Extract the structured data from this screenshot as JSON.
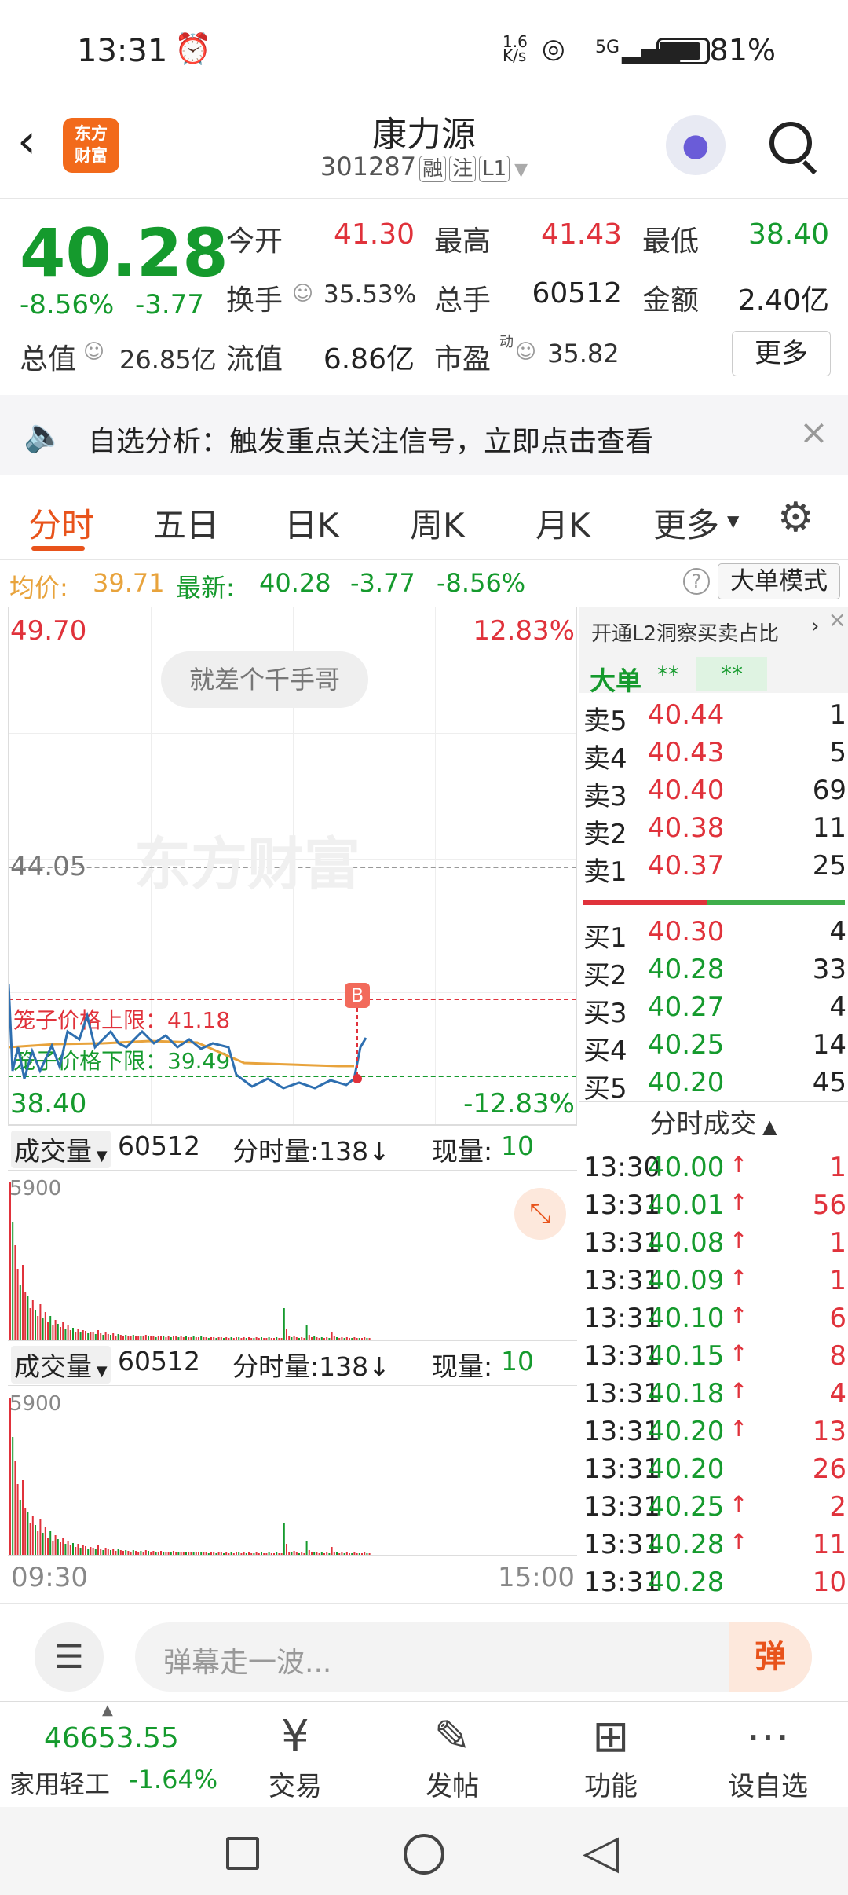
{
  "status": {
    "time": "13:31",
    "alarm_icon": "alarm-icon",
    "net_speed": "1.6 K/s",
    "signal": "5G",
    "battery": "81%"
  },
  "header": {
    "title": "康力源",
    "code": "301287",
    "tags": [
      "融",
      "注",
      "L1"
    ],
    "logo_line1": "东方",
    "logo_line2": "财富"
  },
  "quote": {
    "price": "40.28",
    "change_pct": "-8.56%",
    "change": "-3.77",
    "open_label": "今开",
    "open": "41.30",
    "high_label": "最高",
    "high": "41.43",
    "low_label": "最低",
    "low": "38.40",
    "turnover_label": "换手",
    "turnover": "35.53%",
    "volume_label": "总手",
    "volume": "60512",
    "amount_label": "金额",
    "amount": "2.40亿",
    "mcap_label": "总值",
    "mcap": "26.85亿",
    "float_label": "流值",
    "float": "6.86亿",
    "pe_label": "市盈",
    "pe_sup": "动",
    "pe": "35.82",
    "more_button": "更多"
  },
  "notice": {
    "text": "自选分析：触发重点关注信号，立即点击查看"
  },
  "tabs": [
    "分时",
    "五日",
    "日K",
    "周K",
    "月K",
    "更多"
  ],
  "infobar": {
    "avg_label": "均价:",
    "avg": "39.71",
    "latest_label": "最新:",
    "latest": "40.28",
    "chg": "-3.77",
    "pct": "-8.56%",
    "bigmode": "大单模式"
  },
  "chart": {
    "top_price": "49.70",
    "top_pct": "12.83%",
    "mid_price": "44.05",
    "bot_price": "38.40",
    "bot_pct": "-12.83%",
    "bubble": "就差个千手哥",
    "upper_limit": "笼子价格上限：41.18",
    "lower_limit": "笼子价格下限：39.49",
    "marker": "B",
    "watermark": "东方财富"
  },
  "volbar": {
    "label": "成交量",
    "total": "60512",
    "fs_label": "分时量:138↓",
    "now_label": "现量:",
    "now": "10",
    "max": "5900"
  },
  "axis": {
    "start": "09:30",
    "end": "15:00"
  },
  "book": {
    "promo": "开通L2洞察买卖占比",
    "bigorder": "大单",
    "stars": "**",
    "asks": [
      {
        "l": "卖5",
        "p": "40.44",
        "v": "1"
      },
      {
        "l": "卖4",
        "p": "40.43",
        "v": "5"
      },
      {
        "l": "卖3",
        "p": "40.40",
        "v": "69"
      },
      {
        "l": "卖2",
        "p": "40.38",
        "v": "11"
      },
      {
        "l": "卖1",
        "p": "40.37",
        "v": "25"
      }
    ],
    "bids": [
      {
        "l": "买1",
        "p": "40.30",
        "v": "4"
      },
      {
        "l": "买2",
        "p": "40.28",
        "v": "33"
      },
      {
        "l": "买3",
        "p": "40.27",
        "v": "4"
      },
      {
        "l": "买4",
        "p": "40.25",
        "v": "14"
      },
      {
        "l": "买5",
        "p": "40.20",
        "v": "45"
      }
    ],
    "ticks_title": "分时成交",
    "ticks": [
      {
        "t": "13:30",
        "p": "40.00",
        "v": "1",
        "up": true
      },
      {
        "t": "13:31",
        "p": "40.01",
        "v": "56",
        "up": true
      },
      {
        "t": "13:31",
        "p": "40.08",
        "v": "1",
        "up": true
      },
      {
        "t": "13:31",
        "p": "40.09",
        "v": "1",
        "up": true
      },
      {
        "t": "13:31",
        "p": "40.10",
        "v": "6",
        "up": true
      },
      {
        "t": "13:31",
        "p": "40.15",
        "v": "8",
        "up": true
      },
      {
        "t": "13:31",
        "p": "40.18",
        "v": "4",
        "up": true
      },
      {
        "t": "13:31",
        "p": "40.20",
        "v": "13",
        "up": true
      },
      {
        "t": "13:31",
        "p": "40.20",
        "v": "26",
        "up": false
      },
      {
        "t": "13:31",
        "p": "40.25",
        "v": "2",
        "up": true
      },
      {
        "t": "13:31",
        "p": "40.28",
        "v": "11",
        "up": true
      },
      {
        "t": "13:31",
        "p": "40.28",
        "v": "10",
        "up": false
      }
    ]
  },
  "danmu": {
    "placeholder": "弹幕走一波...",
    "send": "弹"
  },
  "toolbar": {
    "index_value": "46653.55",
    "index_name": "家用轻工",
    "index_pct": "-1.64%",
    "items": [
      "交易",
      "发帖",
      "功能",
      "设自选"
    ]
  },
  "colors": {
    "up": "#e0323b",
    "down": "#159a2d",
    "brand": "#f26a1b",
    "avg_line": "#e8a33c"
  }
}
